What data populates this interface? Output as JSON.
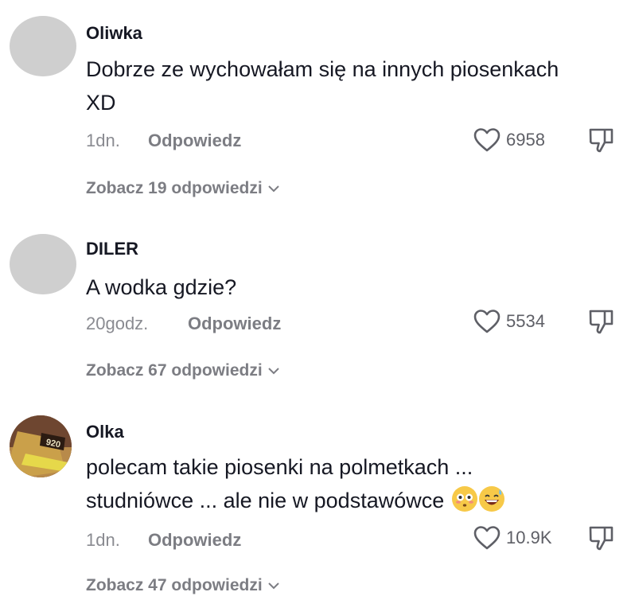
{
  "comments": [
    {
      "username": "Oliwka",
      "text": "Dobrze ze wychowałam się na innych piosenkach XD",
      "time": "1dn.",
      "reply_label": "Odpowiedz",
      "likes": "6958",
      "view_replies": "Zobacz 19 odpowiedzi"
    },
    {
      "username": "DILER",
      "text": "A wodka gdzie?",
      "time": "20godz.",
      "reply_label": "Odpowiedz",
      "likes": "5534",
      "view_replies": "Zobacz 67 odpowiedzi"
    },
    {
      "username": "Olka",
      "text_line1": "polecam takie piosenki na polmetkach ...",
      "text_line2": "studniówce ... ale nie w podstawówce",
      "time": "1dn.",
      "reply_label": "Odpowiedz",
      "likes": "10.9K",
      "view_replies": "Zobacz 47 odpowiedzi",
      "avatar_text": "920"
    }
  ],
  "icons": {
    "like": "heart-outline-icon",
    "dislike": "thumbs-down-icon",
    "expand": "chevron-down-icon"
  },
  "colors": {
    "text": "#161823",
    "muted": "#8a8b91",
    "avatar_placeholder": "#cfcfcf"
  }
}
